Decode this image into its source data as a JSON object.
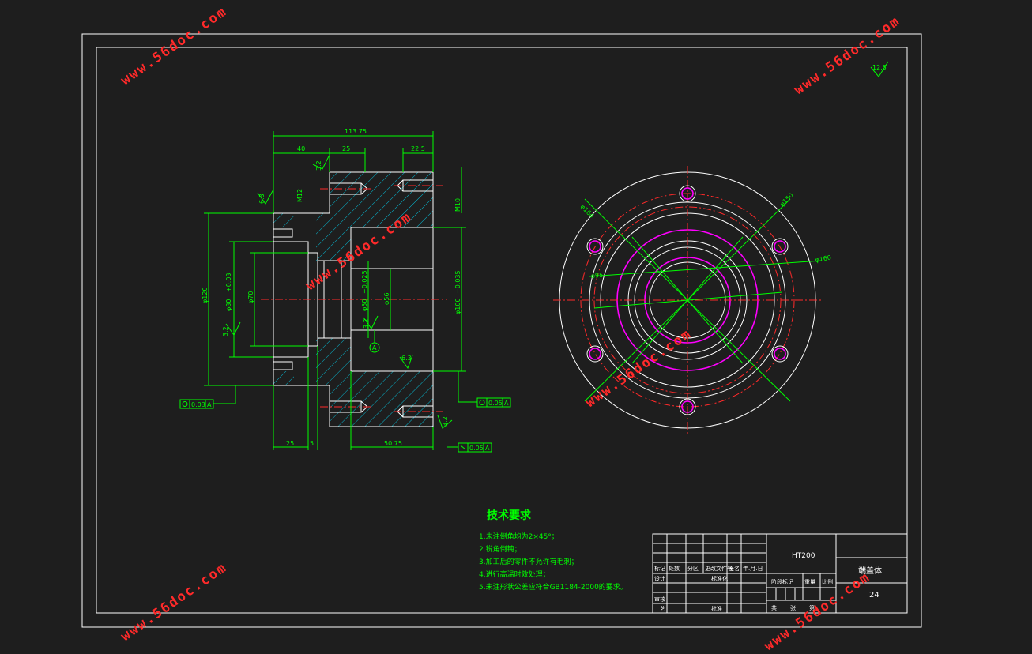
{
  "watermark": "www.56doc.com",
  "roughness_global": "12.5",
  "dimensions": {
    "overall_length": "113.75",
    "flange_left": "40",
    "mid": "25",
    "right_step": "22.5",
    "bottom_left": "25",
    "bottom_small": "5",
    "bottom_right": "50.75",
    "dia_120": "φ120",
    "dia_80": "φ80",
    "dia_80_tol": "+0.03",
    "dia_70": "φ70",
    "dia_56": "φ56",
    "dia_50": "φ50",
    "dia_50_tol": "+0.025",
    "dia_100": "φ100",
    "dia_100_tol": "+0.035",
    "m12": "M12",
    "m10": "M10",
    "dia_164": "φ164",
    "dia_150": "φ150",
    "dia_160": "φ160",
    "dia_95": "φ95"
  },
  "roughness": {
    "r1": "3.2",
    "r2": "6.3",
    "r3": "3.2",
    "r4": "3.2",
    "r5": "6.3",
    "r6": "3.2"
  },
  "tolerance_frames": {
    "left": "0.03",
    "right": "0.05",
    "bottom": "0.05",
    "datum": "A"
  },
  "tech_requirements": {
    "title": "技术要求",
    "items": [
      "1.未注倒角均为2×45°；",
      "2.锐角倒钝；",
      "3.加工后的零件不允许有毛刺；",
      "4.进行高温时效处理；",
      "5.未注形状公差应符合GB1184-2000的要求。"
    ]
  },
  "title_block": {
    "material": "HT200",
    "part_name": "端盖体",
    "scale": "24",
    "headers": [
      "标记",
      "处数",
      "分区",
      "更改文件号",
      "签名",
      "年.月.日"
    ],
    "row2": [
      "设计",
      "标准化"
    ],
    "row3": [
      "审核"
    ],
    "row4": [
      "工艺",
      "批准"
    ],
    "stage": "阶段标记",
    "weight": "重量",
    "ratio": "比例",
    "sheets": "共",
    "sheet": "张",
    "page": "第"
  }
}
